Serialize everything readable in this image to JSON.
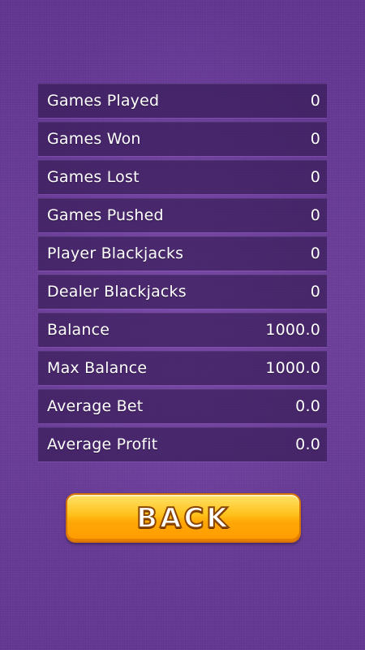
{
  "stats": [
    {
      "label": "Games Played",
      "value": "0"
    },
    {
      "label": "Games Won",
      "value": "0"
    },
    {
      "label": "Games Lost",
      "value": "0"
    },
    {
      "label": "Games Pushed",
      "value": "0"
    },
    {
      "label": "Player Blackjacks",
      "value": "0"
    },
    {
      "label": "Dealer Blackjacks",
      "value": "0"
    },
    {
      "label": "Balance",
      "value": "1000.0"
    },
    {
      "label": "Max Balance",
      "value": "1000.0"
    },
    {
      "label": "Average Bet",
      "value": "0.0"
    },
    {
      "label": "Average Profit",
      "value": "0.0"
    }
  ],
  "back_button": {
    "label": "BACK"
  },
  "colors": {
    "background": "#6a3c97",
    "row": "#30164e",
    "button": "#ffb314",
    "button_border": "#d4730a"
  }
}
